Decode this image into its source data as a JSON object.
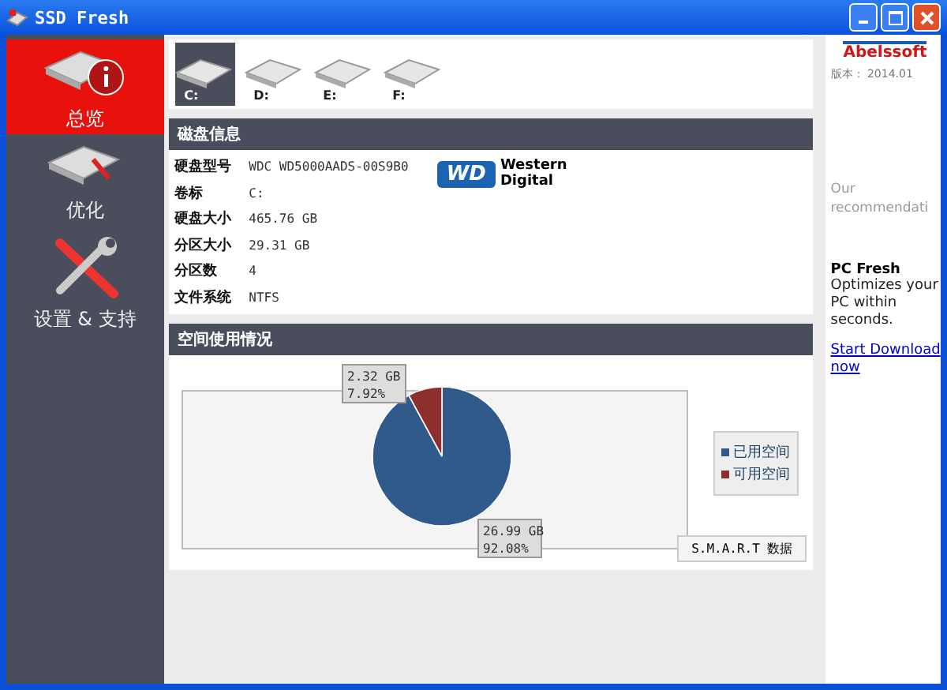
{
  "window": {
    "title": "SSD Fresh"
  },
  "sidebar": {
    "items": [
      {
        "label": "总览",
        "kind": "overview",
        "selected": true
      },
      {
        "label": "优化",
        "kind": "optimize",
        "selected": false
      },
      {
        "label": "设置 & 支持",
        "kind": "settings",
        "selected": false
      }
    ]
  },
  "drives": [
    {
      "label": "C:",
      "selected": true
    },
    {
      "label": "D:",
      "selected": false
    },
    {
      "label": "E:",
      "selected": false
    },
    {
      "label": "F:",
      "selected": false
    }
  ],
  "disk_info": {
    "title": "磁盘信息",
    "rows": [
      {
        "label": "硬盘型号",
        "value": "WDC WD5000AADS-00S9B0"
      },
      {
        "label": "卷标",
        "value": "C:"
      },
      {
        "label": "硬盘大小",
        "value": "465.76 GB"
      },
      {
        "label": "分区大小",
        "value": "29.31 GB"
      },
      {
        "label": "分区数",
        "value": "4"
      },
      {
        "label": "文件系统",
        "value": "NTFS"
      }
    ],
    "logo": {
      "mark": "WD",
      "lines": [
        "Western",
        "Digital"
      ]
    }
  },
  "space_usage": {
    "title": "空间使用情况",
    "chart_data": {
      "type": "pie",
      "categories": [
        "已用空间",
        "可用空间"
      ],
      "values": [
        92.08,
        7.92
      ],
      "colors": [
        "#2f5a8a",
        "#8e2f2f"
      ],
      "value_labels": [
        [
          "26.99 GB",
          "92.08%"
        ],
        [
          "2.32 GB",
          "7.92%"
        ]
      ]
    },
    "button": "S.M.A.R.T 数据"
  },
  "side_panel": {
    "brand": "Abelssoft",
    "version": "版本： 2014.01",
    "heading": "Our recommendati",
    "product": "PC Fresh",
    "description": "Optimizes your PC within seconds.",
    "link": "Start Download now"
  }
}
